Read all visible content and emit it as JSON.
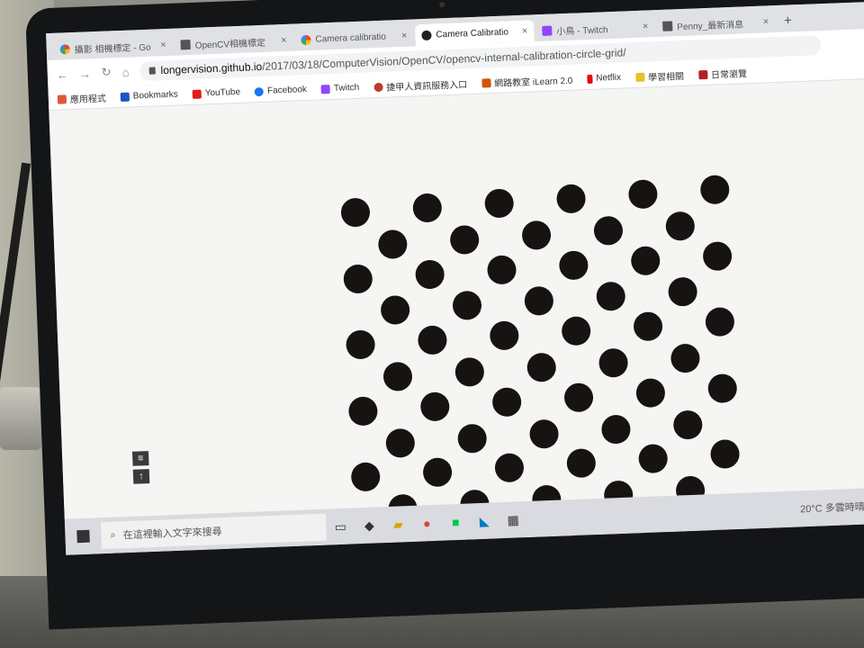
{
  "tabs": [
    {
      "label": "攝影 相機標定 - Go",
      "icon": "google-icon",
      "active": false
    },
    {
      "label": "OpenCV相機標定",
      "icon": "document-icon",
      "active": false
    },
    {
      "label": "Camera calibratio",
      "icon": "google-icon",
      "active": false
    },
    {
      "label": "Camera Calibratio",
      "icon": "github-icon",
      "active": true
    },
    {
      "label": "小鳥 - Twitch",
      "icon": "twitch-icon",
      "active": false
    },
    {
      "label": "Penny_最新消息",
      "icon": "document-icon",
      "active": false
    }
  ],
  "new_tab": "+",
  "address_bar": {
    "host": "longervision.github.io",
    "path": "/2017/03/18/ComputerVision/OpenCV/opencv-internal-calibration-circle-grid/"
  },
  "bookmarks": [
    {
      "label": "應用程式",
      "icon": "apps-icon",
      "color": "#e0573d"
    },
    {
      "label": "Bookmarks",
      "icon": "star-icon",
      "color": "#1a56c2"
    },
    {
      "label": "YouTube",
      "icon": "youtube-icon",
      "color": "#e11d1d"
    },
    {
      "label": "Facebook",
      "icon": "facebook-icon",
      "color": "#1877f2"
    },
    {
      "label": "Twitch",
      "icon": "twitch-icon",
      "color": "#9146ff"
    },
    {
      "label": "捷甲人資訊服務入口",
      "icon": "pin-icon",
      "color": "#c0392b"
    },
    {
      "label": "網路教室 iLearn 2.0",
      "icon": "ilearn-icon",
      "color": "#d35400"
    },
    {
      "label": "Netflix",
      "icon": "netflix-icon",
      "color": "#e50914"
    },
    {
      "label": "學習相關",
      "icon": "folder-icon",
      "color": "#e6c229"
    },
    {
      "label": "日常瀏覽",
      "icon": "folder-icon",
      "color": "#b22222"
    }
  ],
  "pattern": {
    "type": "asymmetric-circle-grid",
    "rows": 11,
    "columns": 4,
    "dot_color": "#171313"
  },
  "taskbar": {
    "search_placeholder": "在這裡輸入文字來搜尋",
    "weather": "20°C 多雲時晴"
  }
}
